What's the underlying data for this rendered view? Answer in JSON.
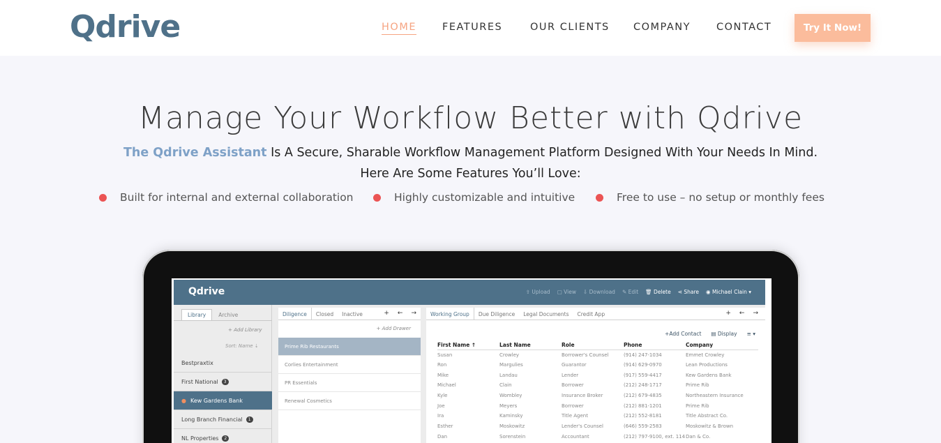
{
  "brand": {
    "logo_text": "Qdrive",
    "logo_color": "#4f7189",
    "accent_color": "#fbbc9c",
    "link_active_color": "#f6a482",
    "bullet_color": "#eb5454",
    "highlight_color": "#7ea1c7"
  },
  "nav": {
    "links": [
      "HOME",
      "FEATURES",
      "OUR CLIENTS",
      "COMPANY",
      "CONTACT"
    ],
    "active": "HOME",
    "cta": "Try It Now!"
  },
  "hero": {
    "title": "Manage Your Workflow Better with Qdrive",
    "subtitle_brand": "The Qdrive Assistant",
    "subtitle_rest": " Is A Secure, Sharable Workflow Management Platform Designed With Your Needs In Mind.",
    "subtitle_line2": "Here Are Some Features You’ll Love:",
    "bullets": [
      "Built for internal and external collaboration",
      "Highly customizable and intuitive",
      "Free to use – no setup or monthly fees"
    ]
  },
  "app": {
    "logo": "Qdrive",
    "actions": [
      "Upload",
      "View",
      "Download",
      "Edit",
      "Delete",
      "Share",
      "Michael Clain"
    ],
    "left_tabs": [
      "Library",
      "Archive"
    ],
    "add_library": "+ Add Library",
    "sort_name": "Sort: Name",
    "libraries": [
      {
        "name": "Bestpraxtix",
        "count": ""
      },
      {
        "name": "First National",
        "count": "3"
      },
      {
        "name": "Kew Gardens Bank",
        "count": ""
      },
      {
        "name": "Long Branch Financial",
        "count": "1"
      },
      {
        "name": "NL Properties",
        "count": "2"
      }
    ],
    "middle_tabs": [
      "Diligence",
      "Closed",
      "Inactive"
    ],
    "add_drawer": "+ Add Drawer",
    "drawers": [
      "Prime Rib Restaurants",
      "Corlies Entertainment",
      "PR Essentials",
      "Renewal Cosmetics"
    ],
    "right_tabs": [
      "Working Group",
      "Due Diligence",
      "Legal Documents",
      "Credit App"
    ],
    "add_contact": "Add Contact",
    "display": "Display",
    "columns": [
      "First Name",
      "Last Name",
      "Role",
      "Phone",
      "Company"
    ],
    "rows": [
      [
        "Susan",
        "Crowley",
        "Borrower's Counsel",
        "(914) 247-1034",
        "Emmet Crowley"
      ],
      [
        "Ron",
        "Margulies",
        "Guarantor",
        "(914) 629-0970",
        "Lean Productions"
      ],
      [
        "Mike",
        "Landau",
        "Lender",
        "(917) 559-4417",
        "Kew Gardens Bank"
      ],
      [
        "Michael",
        "Clain",
        "Borrower",
        "(212) 248-1717",
        "Prime Rib"
      ],
      [
        "Kyle",
        "Wombley",
        "Insurance Broker",
        "(212) 679-4835",
        "Northeastern Insurance"
      ],
      [
        "Joe",
        "Meyers",
        "Borrower",
        "(212) 881-1201",
        "Prime Rib"
      ],
      [
        "Ira",
        "Kaminsky",
        "Title Agent",
        "(212) 552-8181",
        "Title Abstract Co."
      ],
      [
        "Esther",
        "Moskowitz",
        "Lender's Counsel",
        "(646) 559-2583",
        "Moskowitz & Brown"
      ],
      [
        "Dan",
        "Sorenstein",
        "Accountant",
        "(212) 797-9100, ext. 114",
        "Dan & Co."
      ]
    ]
  }
}
